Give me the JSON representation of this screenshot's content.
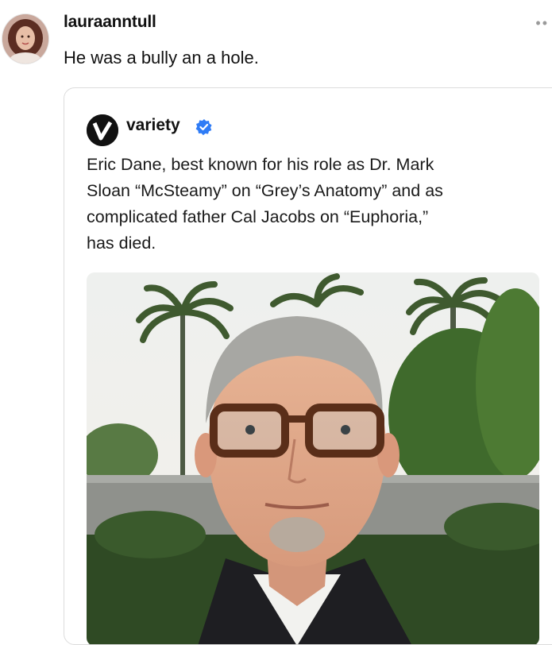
{
  "post": {
    "username": "lauraanntull",
    "text": "He was a bully an a hole.",
    "avatar_icon": "profile-photo",
    "more_icon": "more-horizontal-icon"
  },
  "quoted_post": {
    "username": "variety",
    "verified": true,
    "verified_color": "#2f7cf6",
    "text_lines": [
      "Eric Dane, best known for his role as Dr. Mark",
      "Sloan “McSteamy” on “Grey’s Anatomy” and as",
      "complicated father Cal Jacobs on “Euphoria,”",
      "has died."
    ],
    "image": "photo-man-with-glasses-palm-trees"
  }
}
